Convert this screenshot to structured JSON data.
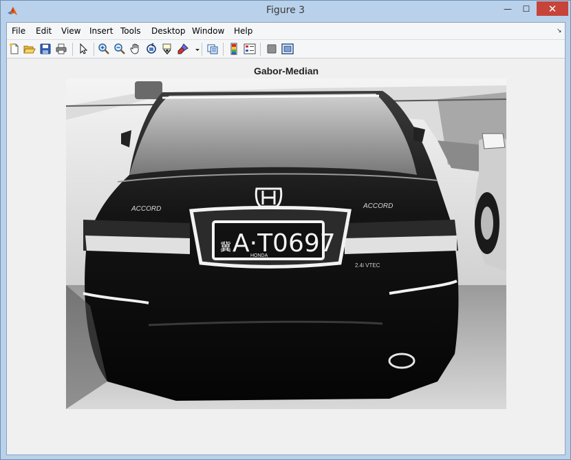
{
  "window": {
    "title": "Figure 3",
    "min_symbol": "—",
    "max_symbol": "☐",
    "close_symbol": "✕"
  },
  "menubar": {
    "items": [
      "File",
      "Edit",
      "View",
      "Insert",
      "Tools",
      "Desktop",
      "Window",
      "Help"
    ],
    "dock_symbol": "↘"
  },
  "toolbar": {
    "tools": [
      {
        "icon": "new-figure-icon"
      },
      {
        "icon": "open-file-icon"
      },
      {
        "icon": "save-icon"
      },
      {
        "icon": "print-icon"
      },
      {
        "icon": "edit-plot-arrow-icon"
      },
      {
        "icon": "zoom-in-icon"
      },
      {
        "icon": "zoom-out-icon"
      },
      {
        "icon": "pan-hand-icon"
      },
      {
        "icon": "rotate-3d-icon"
      },
      {
        "icon": "data-cursor-icon"
      },
      {
        "icon": "brush-icon"
      },
      {
        "icon": "link-plot-icon"
      },
      {
        "icon": "insert-colorbar-icon"
      },
      {
        "icon": "insert-legend-icon"
      },
      {
        "icon": "hide-plot-tools-icon"
      },
      {
        "icon": "show-plot-tools-icon"
      }
    ]
  },
  "figure": {
    "axes_title": "Gabor-Median",
    "image": {
      "subject": "rear view of black sedan with license plate",
      "plate_text": "A·T0697",
      "plate_prefix": "冀",
      "plate_frame_text": "HONDA",
      "badge_left": "ACCORD",
      "badge_right": "ACCORD",
      "trim_text": "2.4i VTEC"
    }
  }
}
